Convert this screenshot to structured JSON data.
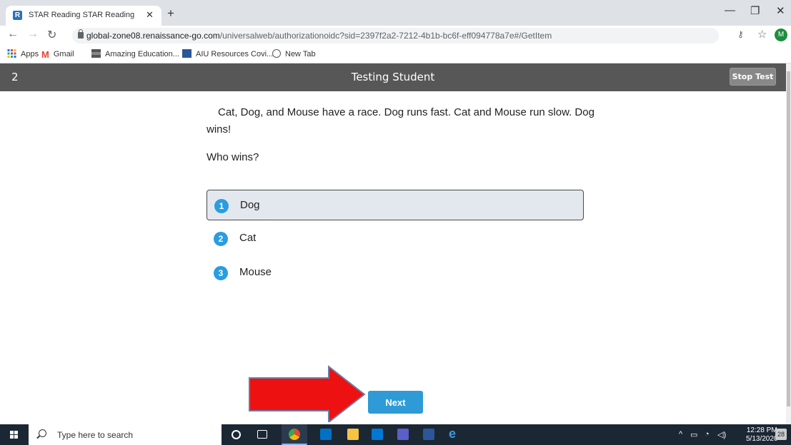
{
  "browser": {
    "tab_title": "STAR Reading STAR Reading Ente",
    "tab_favicon_letter": "R",
    "new_tab_symbol": "+",
    "url_host": "global-zone08.renaissance-go.com",
    "url_path": "/universalweb/authorizationoidc?sid=2397f2a2-7212-4b1b-bc6f-eff094778a7e#/GetItem",
    "profile_initial": "M"
  },
  "bookmarks": [
    "Apps",
    "Gmail",
    "Amazing Education...",
    "AIU Resources Covi...",
    "New Tab"
  ],
  "app": {
    "question_number": "2",
    "student_name": "Testing Student",
    "stop_label": "Stop Test",
    "passage": "Cat, Dog, and Mouse have a race. Dog runs fast. Cat and Mouse run slow. Dog wins!",
    "question": "Who wins?",
    "choices": [
      {
        "num": "1",
        "label": "Dog",
        "selected": true
      },
      {
        "num": "2",
        "label": "Cat",
        "selected": false
      },
      {
        "num": "3",
        "label": "Mouse",
        "selected": false
      }
    ],
    "next_label": "Next"
  },
  "taskbar": {
    "search_placeholder": "Type here to search",
    "time": "12:28 PM",
    "date": "5/13/2020",
    "notification_count": "28"
  },
  "colors": {
    "header_bg": "#575757",
    "accent_blue": "#2e9bd6",
    "arrow_red": "#ee1111"
  }
}
